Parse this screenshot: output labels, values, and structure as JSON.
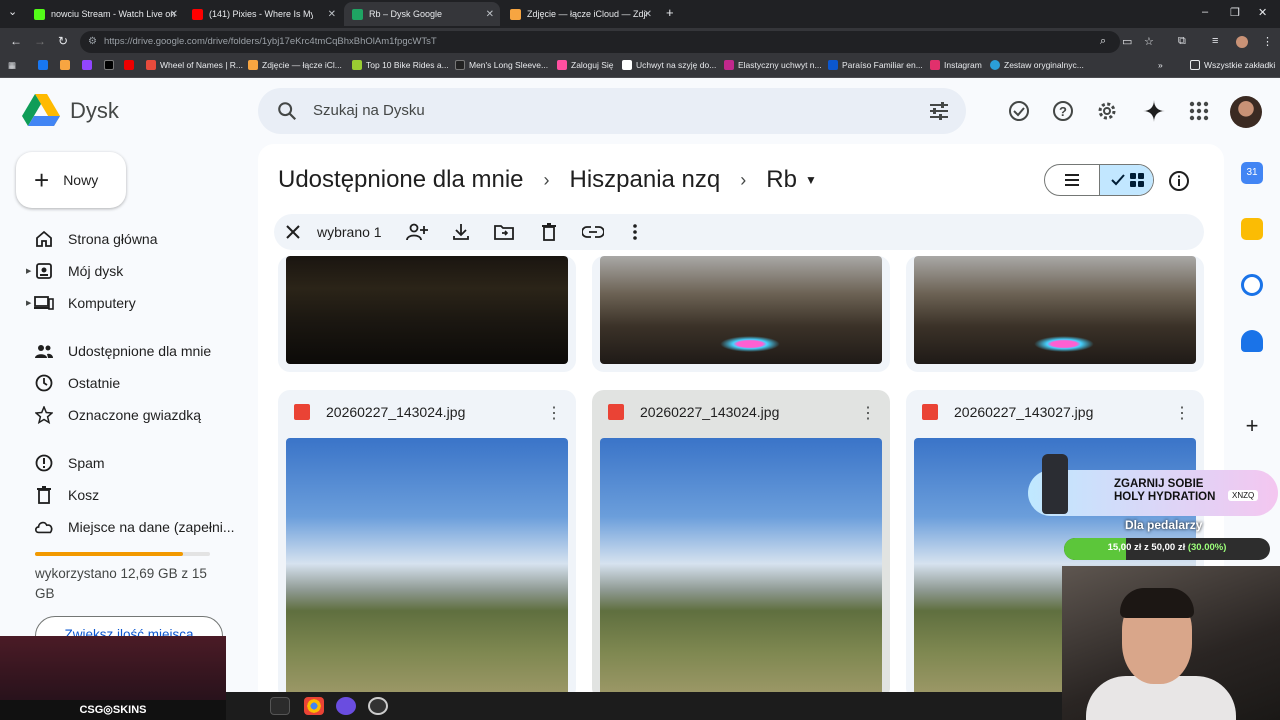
{
  "browser": {
    "tabs": [
      {
        "title": "nowciu Stream - Watch Live on",
        "color": "#53fc18"
      },
      {
        "title": "(141) Pixies - Where Is My Mind",
        "color": "#ff0000"
      },
      {
        "title": "Rb – Dysk Google",
        "color": "#1fa463"
      },
      {
        "title": "Zdjęcie — łącze iCloud — Zdjęcie",
        "color": "#f7a541"
      }
    ],
    "url": "https://drive.google.com/drive/folders/1ybj17eKrc4tmCqBhxBhOlAm1fpgcWTsT",
    "bookmarks": [
      "Wheel of Names | R...",
      "Zdjęcie — łącze iCl...",
      "Top 10 Bike Rides a...",
      "Men's Long Sleeve...",
      "Zaloguj Się",
      "Uchwyt na szyję do...",
      "Elastyczny uchwyt n...",
      "Paraíso Familiar en...",
      "Instagram",
      "Zestaw oryginalnyc..."
    ],
    "all_bookmarks": "Wszystkie zakładki"
  },
  "app": {
    "title": "Dysk",
    "search_placeholder": "Szukaj na Dysku",
    "new_label": "Nowy"
  },
  "sidebar": {
    "items": [
      {
        "label": "Strona główna",
        "icon": "home-icon"
      },
      {
        "label": "Mój dysk",
        "icon": "my-drive-icon"
      },
      {
        "label": "Komputery",
        "icon": "computers-icon"
      },
      {
        "label": "Udostępnione dla mnie",
        "icon": "shared-icon"
      },
      {
        "label": "Ostatnie",
        "icon": "clock-icon"
      },
      {
        "label": "Oznaczone gwiazdką",
        "icon": "star-icon"
      },
      {
        "label": "Spam",
        "icon": "spam-icon"
      },
      {
        "label": "Kosz",
        "icon": "trash-icon"
      },
      {
        "label": "Miejsce na dane (zapełni...",
        "icon": "cloud-icon"
      }
    ],
    "storage_text": "wykorzystano 12,69 GB z 15 GB",
    "storage_used_fraction": 0.846,
    "upgrade_label": "Zwiększ ilość miejsca"
  },
  "breadcrumb": [
    "Udostępnione dla mnie",
    "Hiszpania nzq",
    "Rb"
  ],
  "selection": {
    "count_label": "wybrano 1"
  },
  "files": [
    {
      "name": "20260227_143024.jpg",
      "selected": false
    },
    {
      "name": "20260227_143024.jpg",
      "selected": true
    },
    {
      "name": "20260227_143027.jpg",
      "selected": false
    }
  ],
  "overlay": {
    "promo_title": "ZGARNIJ SOBIE HOLY HYDRATION",
    "promo_code": "XNZQ",
    "promo_sub": "Dla pedalarzy",
    "goal_amount": "15,00 zł z 50,00 zł",
    "goal_pct": "(30.00%)",
    "goal_fraction": 0.3,
    "game_brand": "CSG◎SKINS"
  },
  "colors": {
    "accent": "#0b57d0",
    "selected_view": "#c2e7ff",
    "storage": "#f29900",
    "image_icon": "#ea4335"
  }
}
